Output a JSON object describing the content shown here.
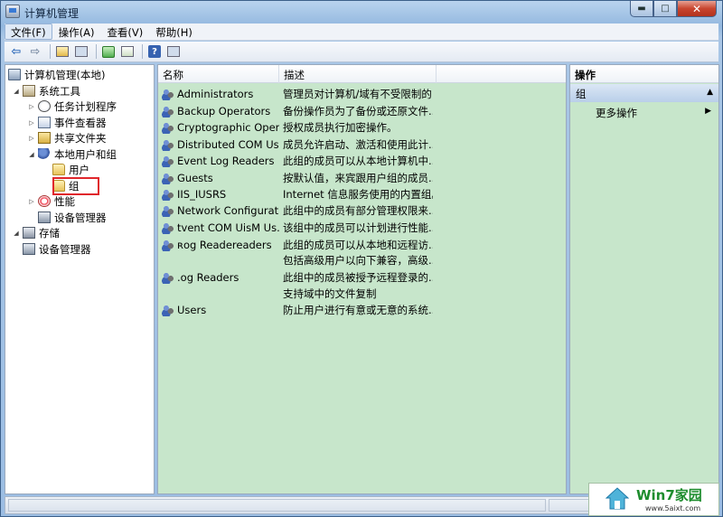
{
  "window": {
    "title": "计算机管理",
    "buttons": {
      "minimize": "▬",
      "maximize": "□",
      "close": "✕"
    }
  },
  "menubar": [
    {
      "label": "文件(F)"
    },
    {
      "label": "操作(A)"
    },
    {
      "label": "查看(V)"
    },
    {
      "label": "帮助(H)"
    }
  ],
  "toolbar": {
    "help_glyph": "?"
  },
  "tree": [
    {
      "label": "计算机管理(本地)",
      "icon": "computer-icon"
    },
    {
      "label": "系统工具",
      "icon": "tools-icon"
    },
    {
      "label": "任务计划程序",
      "icon": "clock-icon"
    },
    {
      "label": "事件查看器",
      "icon": "event-viewer-icon"
    },
    {
      "label": "共享文件夹",
      "icon": "shared-folder-icon"
    },
    {
      "label": "本地用户和组",
      "icon": "users-icon"
    },
    {
      "label": "用户",
      "icon": "folder-icon"
    },
    {
      "label": "组",
      "icon": "folder-icon"
    },
    {
      "label": "性能",
      "icon": "performance-icon"
    },
    {
      "label": "设备管理器",
      "icon": "device-manager-icon"
    },
    {
      "label": "存储",
      "icon": "storage-icon"
    },
    {
      "label": "设备管理器",
      "icon": "disk-management-icon"
    }
  ],
  "list": {
    "columns": [
      "名称",
      "描述"
    ],
    "rows": [
      {
        "name": "Administrators",
        "desc": "管理员对计算机/域有不受限制的..."
      },
      {
        "name": "Backup Operators",
        "desc": "备份操作员为了备份或还原文件..."
      },
      {
        "name": "Cryptographic Oper...",
        "desc": "授权成员执行加密操作。"
      },
      {
        "name": "Distributed COM Us...",
        "desc": "成员允许启动、激活和使用此计..."
      },
      {
        "name": "Event Log Readers",
        "desc": "此组的成员可以从本地计算机中..."
      },
      {
        "name": "Guests",
        "desc": "按默认值，来宾跟用户组的成员..."
      },
      {
        "name": "IIS_IUSRS",
        "desc": "Internet 信息服务使用的内置组。"
      },
      {
        "name": "Network Configurat...",
        "desc": "此组中的成员有部分管理权限来..."
      },
      {
        "name": "tvent COM UisM Us...",
        "desc": "该组中的成员可以计划进行性能..."
      },
      {
        "name": "ʀog Readereaders",
        "desc": "此组的成员可以从本地和远程访..."
      },
      {
        "name": "",
        "desc": "包括高级用户以向下兼容，高级..."
      },
      {
        "name": ".og Readers",
        "desc": "此组中的成员被授予远程登录的..."
      },
      {
        "name": "",
        "desc": "支持域中的文件复制"
      },
      {
        "name": "Users",
        "desc": "防止用户进行有意或无意的系统..."
      }
    ]
  },
  "actions": {
    "title": "操作",
    "group": "组",
    "more": "更多操作"
  },
  "watermark": {
    "brand": "Win7家园",
    "url": "www.5aixt.com"
  }
}
